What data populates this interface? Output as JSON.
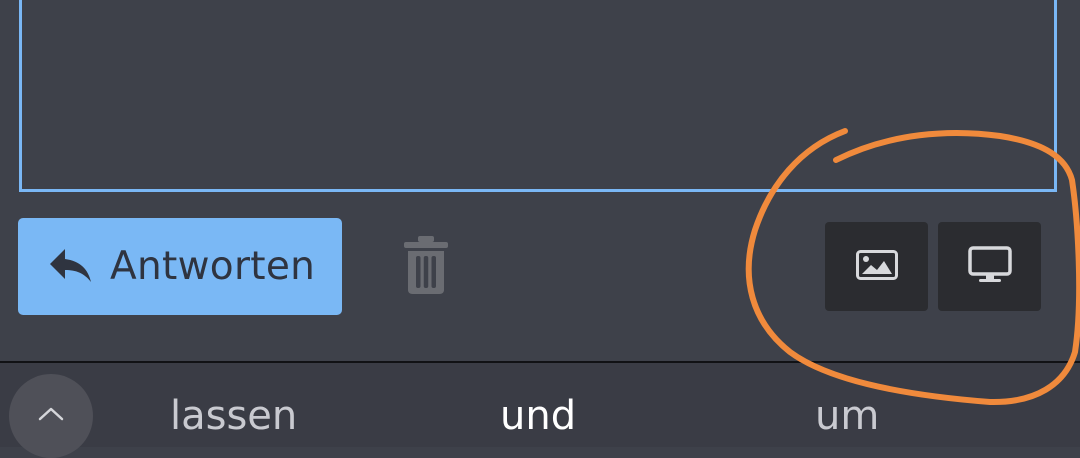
{
  "reply_box": {
    "value": ""
  },
  "actions": {
    "reply_label": "Antworten",
    "reply_icon": "reply-arrow-icon",
    "delete_icon": "trash-icon"
  },
  "tools": [
    {
      "icon": "image-icon"
    },
    {
      "icon": "monitor-icon"
    }
  ],
  "keyboard": {
    "expand_icon": "chevron-up-icon",
    "suggestions": [
      "lassen",
      "und",
      "um"
    ]
  },
  "colors": {
    "background": "#3e414a",
    "accent": "#7ab8f5",
    "tool_button": "#2b2c30",
    "annotation": "#f08a3c"
  }
}
